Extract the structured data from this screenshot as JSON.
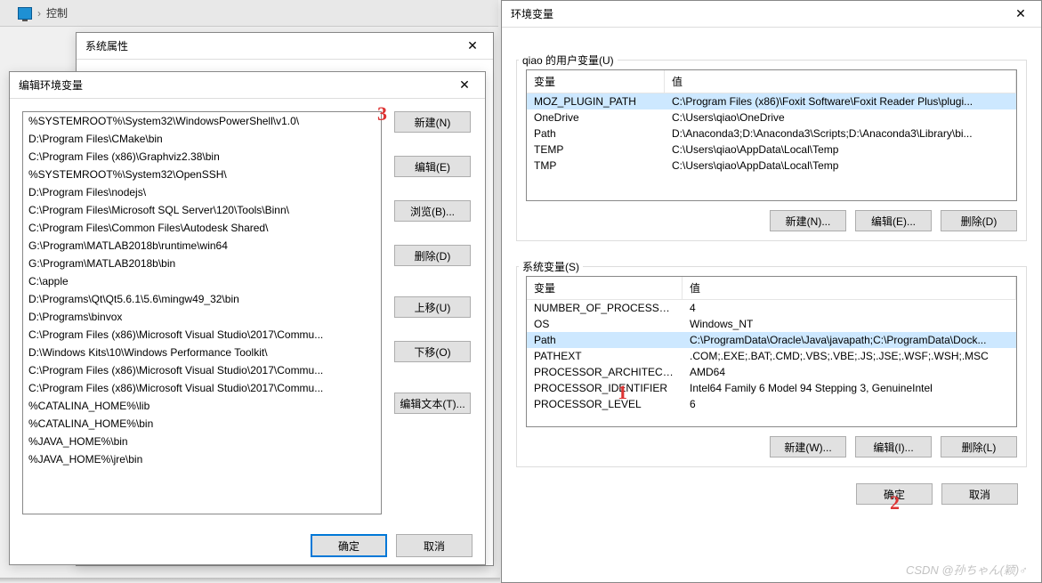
{
  "breadcrumb": {
    "label": "控制"
  },
  "sysprops": {
    "title": "系统属性"
  },
  "editenv": {
    "title": "编辑环境变量",
    "paths": [
      "%SYSTEMROOT%\\System32\\WindowsPowerShell\\v1.0\\",
      "D:\\Program Files\\CMake\\bin",
      "C:\\Program Files (x86)\\Graphviz2.38\\bin",
      "%SYSTEMROOT%\\System32\\OpenSSH\\",
      "D:\\Program Files\\nodejs\\",
      "C:\\Program Files\\Microsoft SQL Server\\120\\Tools\\Binn\\",
      "C:\\Program Files\\Common Files\\Autodesk Shared\\",
      "G:\\Program\\MATLAB2018b\\runtime\\win64",
      "G:\\Program\\MATLAB2018b\\bin",
      "C:\\apple",
      "D:\\Programs\\Qt\\Qt5.6.1\\5.6\\mingw49_32\\bin",
      "D:\\Programs\\binvox",
      "C:\\Program Files (x86)\\Microsoft Visual Studio\\2017\\Commu...",
      "D:\\Windows Kits\\10\\Windows Performance Toolkit\\",
      "C:\\Program Files (x86)\\Microsoft Visual Studio\\2017\\Commu...",
      "C:\\Program Files (x86)\\Microsoft Visual Studio\\2017\\Commu...",
      "%CATALINA_HOME%\\lib",
      "%CATALINA_HOME%\\bin",
      "%JAVA_HOME%\\bin",
      "%JAVA_HOME%\\jre\\bin"
    ],
    "buttons": {
      "new": "新建(N)",
      "edit": "编辑(E)",
      "browse": "浏览(B)...",
      "delete": "删除(D)",
      "moveup": "上移(U)",
      "movedown": "下移(O)",
      "edittext": "编辑文本(T)..."
    },
    "ok": "确定",
    "cancel": "取消"
  },
  "envvars": {
    "title": "环境变量",
    "user_group_label": "qiao 的用户变量(U)",
    "sys_group_label": "系统变量(S)",
    "col_var": "变量",
    "col_val": "值",
    "user_vars": [
      {
        "name": "MOZ_PLUGIN_PATH",
        "value": "C:\\Program Files (x86)\\Foxit Software\\Foxit Reader Plus\\plugi..."
      },
      {
        "name": "OneDrive",
        "value": "C:\\Users\\qiao\\OneDrive"
      },
      {
        "name": "Path",
        "value": "D:\\Anaconda3;D:\\Anaconda3\\Scripts;D:\\Anaconda3\\Library\\bi..."
      },
      {
        "name": "TEMP",
        "value": "C:\\Users\\qiao\\AppData\\Local\\Temp"
      },
      {
        "name": "TMP",
        "value": "C:\\Users\\qiao\\AppData\\Local\\Temp"
      }
    ],
    "sys_vars": [
      {
        "name": "NUMBER_OF_PROCESSORS",
        "value": "4"
      },
      {
        "name": "OS",
        "value": "Windows_NT"
      },
      {
        "name": "Path",
        "value": "C:\\ProgramData\\Oracle\\Java\\javapath;C:\\ProgramData\\Dock..."
      },
      {
        "name": "PATHEXT",
        "value": ".COM;.EXE;.BAT;.CMD;.VBS;.VBE;.JS;.JSE;.WSF;.WSH;.MSC"
      },
      {
        "name": "PROCESSOR_ARCHITECT...",
        "value": "AMD64"
      },
      {
        "name": "PROCESSOR_IDENTIFIER",
        "value": "Intel64 Family 6 Model 94 Stepping 3, GenuineIntel"
      },
      {
        "name": "PROCESSOR_LEVEL",
        "value": "6"
      }
    ],
    "buttons": {
      "user_new": "新建(N)...",
      "user_edit": "编辑(E)...",
      "user_delete": "删除(D)",
      "sys_new": "新建(W)...",
      "sys_edit": "编辑(I)...",
      "sys_delete": "删除(L)"
    },
    "ok": "确定",
    "cancel": "取消"
  },
  "annotations": {
    "a1": "1",
    "a2": "2",
    "a3": "3"
  },
  "watermark": "CSDN @孙ちゃん(颖)♂"
}
